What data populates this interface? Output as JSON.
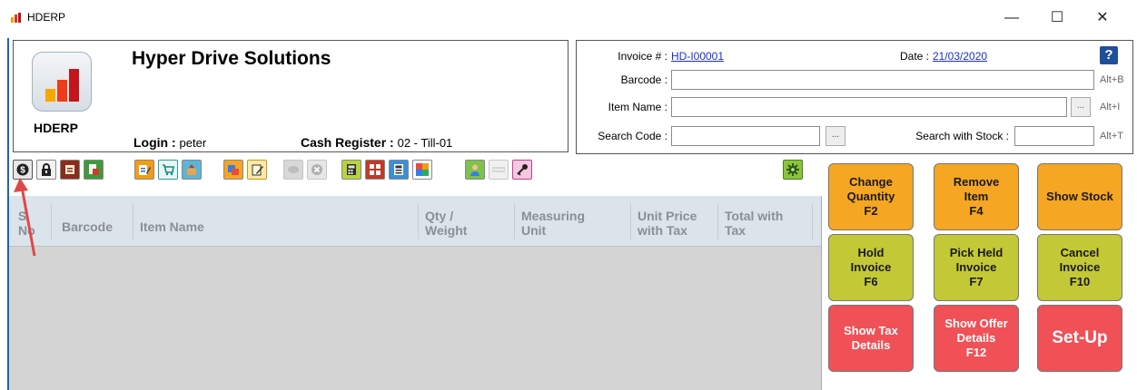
{
  "window": {
    "title": "HDERP",
    "minimize_glyph": "—",
    "maximize_glyph": "☐",
    "close_glyph": "✕"
  },
  "company": {
    "name": "Hyper Drive Solutions",
    "logo_label": "HDERP",
    "login_label": "Login :",
    "login_value": "peter",
    "register_label": "Cash Register :",
    "register_value": "02 - Till-01"
  },
  "invoice": {
    "invoice_label": "Invoice # :",
    "invoice_number": "HD-I00001",
    "date_label": "Date :",
    "date_value": "21/03/2020",
    "barcode_label": "Barcode :",
    "barcode_hint": "Alt+B",
    "item_name_label": "Item Name :",
    "item_name_hint": "Alt+I",
    "search_code_label": "Search Code :",
    "search_stock_label": "Search with Stock :",
    "search_hint": "Alt+T",
    "ellipsis": "...",
    "help_glyph": "?"
  },
  "grid": {
    "columns": [
      "S No",
      "Barcode",
      "Item Name",
      "Qty / Weight",
      "Measuring Unit",
      "Unit Price with Tax",
      "Total with Tax"
    ]
  },
  "actions": {
    "change_quantity": "Change\nQuantity\nF2",
    "remove_item": "Remove\nItem\nF4",
    "show_stock": "Show Stock",
    "hold_invoice": "Hold\nInvoice\nF6",
    "pick_held_invoice": "Pick Held\nInvoice\nF7",
    "cancel_invoice": "Cancel\nInvoice\nF10",
    "show_tax_details": "Show Tax\nDetails",
    "show_offer_details": "Show Offer\nDetails\nF12",
    "setup": "Set-Up"
  },
  "colors": {
    "orange": "#f5a623",
    "olive": "#c3c836",
    "red": "#ef5157",
    "link": "#1a2fd6"
  },
  "toolbar_icons": [
    "dollar-icon",
    "lock-icon",
    "report-icon",
    "report-export-icon",
    "edit-list-icon",
    "cart-icon",
    "cart-upload-icon",
    "transfer-icon",
    "note-edit-icon",
    "disabled-coin-icon",
    "disabled-cancel-icon",
    "calculator-icon",
    "keyboard-icon",
    "calculator-alt-icon",
    "tiles-icon",
    "user-icon",
    "counter-icon",
    "key-icon",
    "settings-icon"
  ]
}
